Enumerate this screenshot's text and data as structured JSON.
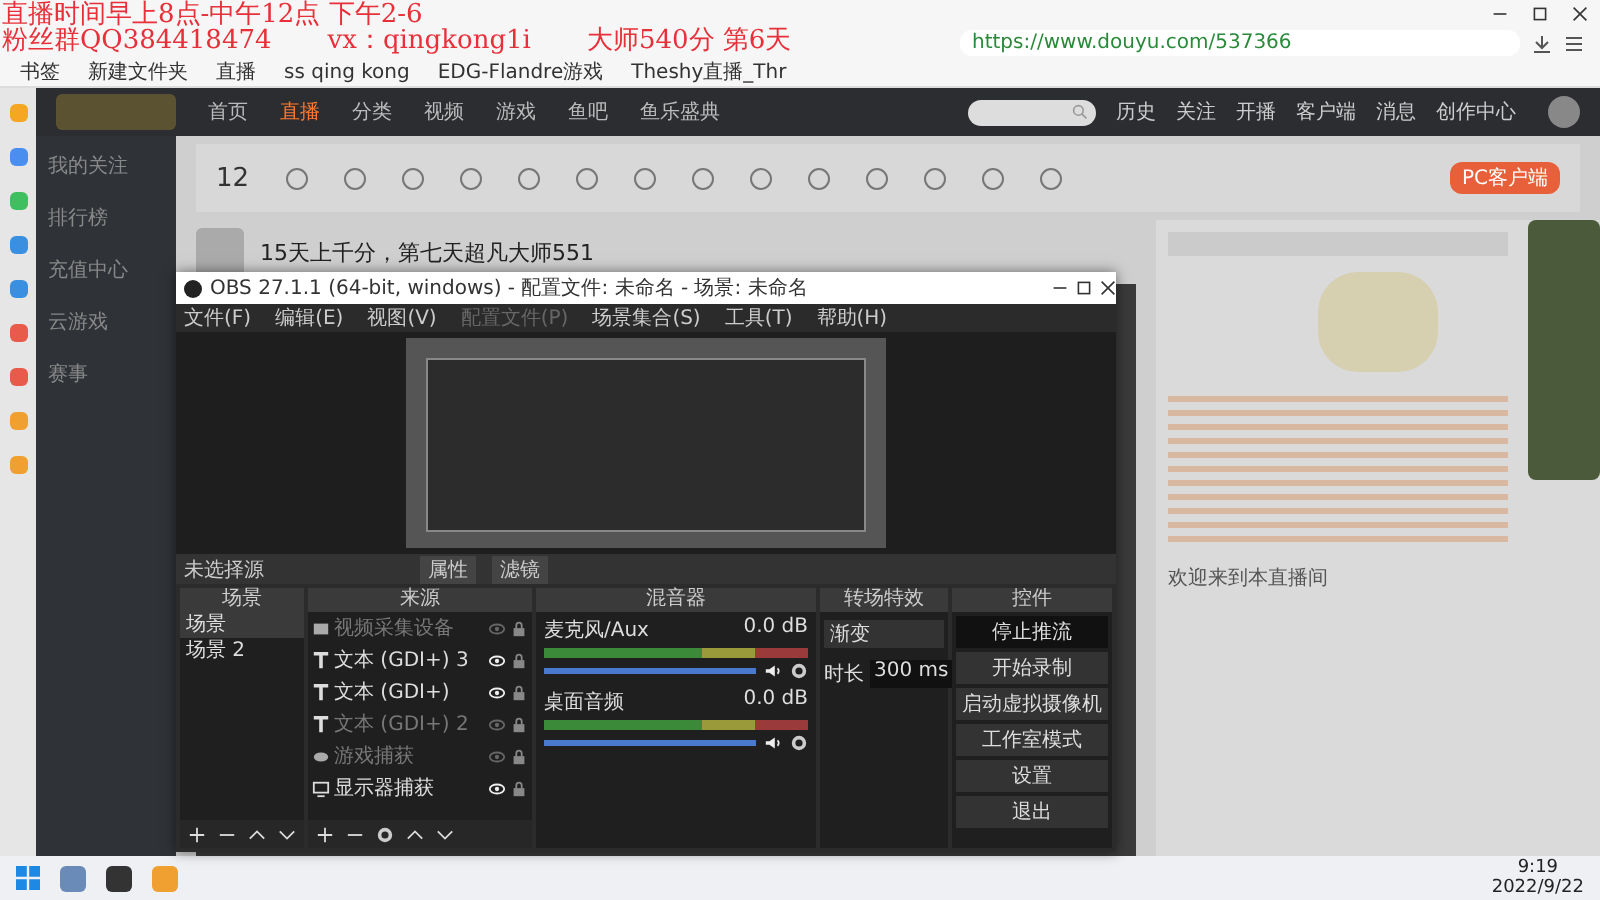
{
  "overlay": {
    "lines": [
      "直播时间早上8点-中午12点 下午2-6",
      "粉丝群QQ384418474",
      "vx：qingkong1i",
      "大师540分 第6天"
    ]
  },
  "browser": {
    "url": "https://www.douyu.com/537366",
    "bookmarks": [
      "书签",
      "新建文件夹",
      "直播",
      "ss qing kong",
      "EDG-Flandre游戏",
      "Theshy直播_Thr"
    ]
  },
  "site": {
    "nav": [
      {
        "label": "首页",
        "selected": false
      },
      {
        "label": "直播",
        "selected": true
      },
      {
        "label": "分类",
        "selected": false
      },
      {
        "label": "视频",
        "selected": false
      },
      {
        "label": "游戏",
        "selected": false
      },
      {
        "label": "鱼吧",
        "selected": false
      },
      {
        "label": "鱼乐盛典",
        "selected": false
      }
    ],
    "header_icons": [
      "历史",
      "关注",
      "开播",
      "客户端",
      "消息",
      "创作中心"
    ],
    "sidebar": [
      "我的关注",
      "排行榜",
      "充值中心",
      "云游戏",
      "赛事"
    ],
    "points": "12",
    "client_button": "PC客户端",
    "stream_title": "15天上千分，第七天超凡大师551",
    "chat_notice": "欢迎来到本直播间"
  },
  "obs": {
    "title": "OBS 27.1.1 (64-bit, windows) - 配置文件: 未命名 - 场景: 未命名",
    "menu": [
      {
        "label": "文件(F)",
        "disabled": false
      },
      {
        "label": "编辑(E)",
        "disabled": false
      },
      {
        "label": "视图(V)",
        "disabled": false
      },
      {
        "label": "配置文件(P)",
        "disabled": true
      },
      {
        "label": "场景集合(S)",
        "disabled": false
      },
      {
        "label": "工具(T)",
        "disabled": false
      },
      {
        "label": "帮助(H)",
        "disabled": false
      }
    ],
    "no_source": "未选择源",
    "props_buttons": [
      "属性",
      "滤镜"
    ],
    "docks": [
      "场景",
      "来源",
      "混音器",
      "转场特效",
      "控件"
    ],
    "scenes": [
      {
        "name": "场景",
        "selected": true
      },
      {
        "name": "场景 2",
        "selected": false
      }
    ],
    "sources": [
      {
        "name": "视频采集设备",
        "kind": "video",
        "visible": false
      },
      {
        "name": "文本 (GDI+) 3",
        "kind": "text",
        "visible": true
      },
      {
        "name": "文本 (GDI+)",
        "kind": "text",
        "visible": true
      },
      {
        "name": "文本 (GDI+) 2",
        "kind": "text",
        "visible": false
      },
      {
        "name": "游戏捕获",
        "kind": "game",
        "visible": false
      },
      {
        "name": "显示器捕获",
        "kind": "display",
        "visible": true
      }
    ],
    "mixer": [
      {
        "name": "麦克风/Aux",
        "reading": "0.0 dB",
        "level": 1
      },
      {
        "name": "桌面音频",
        "reading": "0.0 dB",
        "level": 1
      }
    ],
    "transition": {
      "value": "渐变",
      "duration_label": "时长",
      "duration": "300 ms"
    },
    "controls": [
      {
        "label": "停止推流",
        "active": true
      },
      {
        "label": "开始录制",
        "active": false
      },
      {
        "label": "启动虚拟摄像机",
        "active": false
      },
      {
        "label": "工作室模式",
        "active": false
      },
      {
        "label": "设置",
        "active": false
      },
      {
        "label": "退出",
        "active": false
      }
    ]
  },
  "taskbar": {
    "time": "9:19",
    "date": "2022/9/22"
  }
}
